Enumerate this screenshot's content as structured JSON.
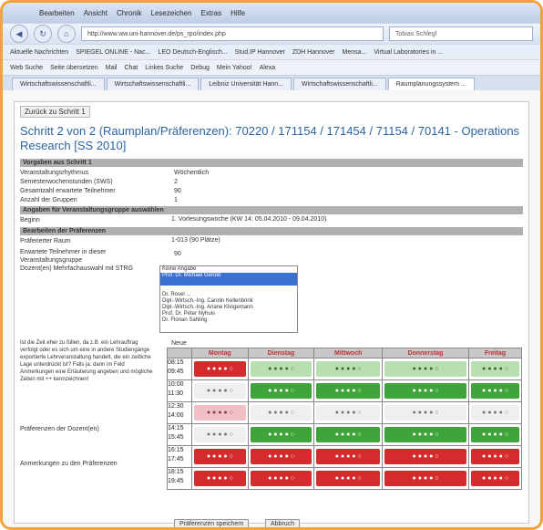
{
  "menu": {
    "items": [
      "Bearbeiten",
      "Ansicht",
      "Chronik",
      "Lesezeichen",
      "Extras",
      "Hilfe"
    ],
    "user": "Tobias Schlegl"
  },
  "nav": {
    "url": "http://www.ww.uni-hannover.de/ps_rpo/index.php",
    "search_placeholder": ""
  },
  "bookmarks": [
    "Aktuelle Nachrichten",
    "SPIEGEL ONLINE - Nac...",
    "LEO Deutsch-Englisch...",
    "Stud.IP Hannover",
    "ZDH Hannover",
    "Mensa...",
    "Virtual Laboratories in ..."
  ],
  "toolbar2": [
    "Web Suche",
    "Seite übersetzen",
    "Mail",
    "Chat",
    "Linkes Suche",
    "Debug",
    "Mein Yahoo!",
    "Alexa"
  ],
  "tabs": [
    "Wirtschaftswissenschaftli...",
    "Wirtschaftswissenschaftli...",
    "Leibniz Universität Hann...",
    "Wirtschaftswissenschaftli...",
    "Raumplanungssystem ..."
  ],
  "page": {
    "back_button": "Zurück zu Schritt 1",
    "title": "Schritt 2 von 2 (Raumplan/Präferenzen): 70220 / 171154 / 171454 / 71154 / 70141 - Operations Research [SS 2010]",
    "section1": "Vorgaben aus Schritt 1",
    "rows1": [
      {
        "label": "Veranstaltungsrhythmus",
        "value": "Wöchentlich"
      },
      {
        "label": "Semesterwochenstunden (SWS)",
        "value": "2"
      },
      {
        "label": "Gesamtzahl erwartete Teilnehmer",
        "value": "90"
      },
      {
        "label": "Anzahl der Gruppen",
        "value": "1"
      }
    ],
    "section2": "Angaben für Veranstaltungsgruppe auswählen",
    "begin_label": "Beginn",
    "begin_value": "1. Vorlesungswoche (KW 14: 05.04.2010 - 09.04.2010)",
    "section3": "Bearbeiten der Präferenzen",
    "room_label": "Präferierter Raum",
    "room_value": "1-013 (90 Plätze)",
    "participants_label": "Erwartete Teilnehmer in dieser Veranstaltungsgruppe",
    "participants_value": "90",
    "lecturer_label": "Dozent(en) Mehrfachauswahl mit STRG",
    "lecturers": [
      "Keine Angabe",
      "Prof. Dr. Michael Gerold",
      "",
      "",
      "Dr. Rosel ...",
      "Dipl.-Wirtsch.-Ing. Carolin Kellenbrink",
      "Dipl.-Wirtsch.-Ing. Ariane Klingemann",
      "Prof. Dr. Peter Nyhuis",
      "Dr. Florian Sahling"
    ],
    "note_text": "Ist die Zeit eher zu füllen, da z.B. ein Lehrauftrag verfolgt oder es sich um eine in andere Studiengänge exportierte Lehrveranstaltung handelt, die ein zeitliche Lage unterdrückt ist? Falls ja: dann im Feld Anmerkungen eine Erläuterung angeben und mögliche Zeiten mit ++ kennzeichnen!",
    "now_label": "Neue",
    "pref_label": "Präferenzen der Dozent(en)",
    "remarks_label": "Anmerkungen zu den Präferenzen",
    "save_button": "Präferenzen speichern",
    "cancel_button": "Abbruch"
  },
  "schedule": {
    "days": [
      "Montag",
      "Dienstag",
      "Mittwoch",
      "Donnerstag",
      "Freitag"
    ],
    "slots": [
      {
        "start": "08:15",
        "end": "09:45",
        "cells": [
          "red",
          "lgreen",
          "lgreen",
          "lgreen",
          "lgreen"
        ]
      },
      {
        "start": "10:00",
        "end": "11:30",
        "cells": [
          "gray",
          "green",
          "green",
          "green",
          "green"
        ]
      },
      {
        "start": "12:30",
        "end": "14:00",
        "cells": [
          "pink",
          "gray",
          "gray",
          "gray",
          "gray"
        ]
      },
      {
        "start": "14:15",
        "end": "15:45",
        "cells": [
          "gray",
          "green",
          "green",
          "green",
          "green"
        ]
      },
      {
        "start": "16:15",
        "end": "17:45",
        "cells": [
          "red",
          "red",
          "red",
          "red",
          "red"
        ]
      },
      {
        "start": "18:15",
        "end": "19:45",
        "cells": [
          "red",
          "red",
          "red",
          "red",
          "red"
        ]
      }
    ]
  },
  "colors": {
    "frame": "#f2a23a",
    "title": "#2a64a3",
    "red": "#d42c2c",
    "green": "#3fa53b"
  }
}
